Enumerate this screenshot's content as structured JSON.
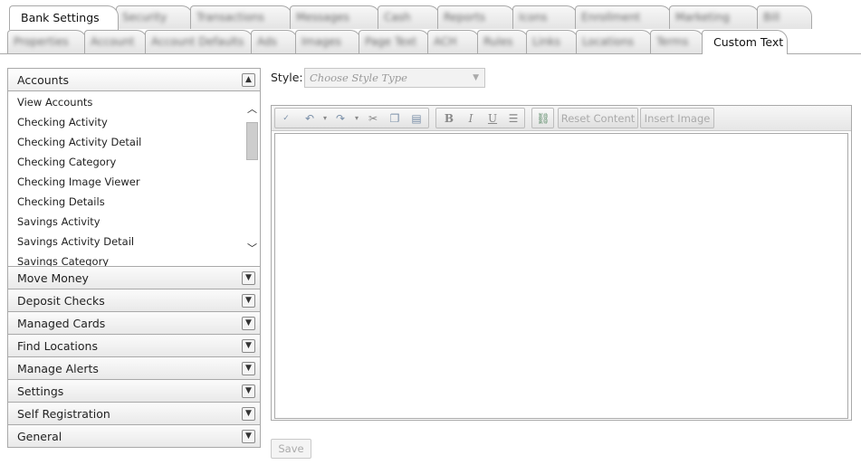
{
  "tabs_row1": [
    {
      "label": "Bank Settings",
      "active": true
    },
    {
      "label": "Security",
      "active": false
    },
    {
      "label": "Transactions",
      "active": false
    },
    {
      "label": "Messages",
      "active": false
    },
    {
      "label": "Cash",
      "active": false
    },
    {
      "label": "Reports",
      "active": false
    },
    {
      "label": "Icons",
      "active": false
    },
    {
      "label": "Enrollment",
      "active": false
    },
    {
      "label": "Marketing",
      "active": false
    },
    {
      "label": "Bill",
      "active": false
    }
  ],
  "tabs_row2": [
    {
      "label": "Properties",
      "active": false
    },
    {
      "label": "Account",
      "active": false
    },
    {
      "label": "Account Defaults",
      "active": false
    },
    {
      "label": "Ads",
      "active": false
    },
    {
      "label": "Images",
      "active": false
    },
    {
      "label": "Page Text",
      "active": false
    },
    {
      "label": "ACH",
      "active": false
    },
    {
      "label": "Rules",
      "active": false
    },
    {
      "label": "Links",
      "active": false
    },
    {
      "label": "Locations",
      "active": false
    },
    {
      "label": "Terms",
      "active": false
    },
    {
      "label": "Custom Text",
      "active": true
    }
  ],
  "accordion": {
    "open_section": "Accounts",
    "open_items": [
      "View Accounts",
      "Checking Activity",
      "Checking Activity Detail",
      "Checking Category",
      "Checking Image Viewer",
      "Checking Details",
      "Savings Activity",
      "Savings Activity Detail",
      "Savings Category"
    ],
    "sections": [
      "Move Money",
      "Deposit Checks",
      "Managed Cards",
      "Find Locations",
      "Manage Alerts",
      "Settings",
      "Self Registration",
      "General"
    ]
  },
  "style": {
    "label": "Style:",
    "placeholder": "Choose Style Type"
  },
  "toolbar": {
    "reset_label": "Reset Content",
    "insert_label": "Insert Image"
  },
  "save_label": "Save"
}
